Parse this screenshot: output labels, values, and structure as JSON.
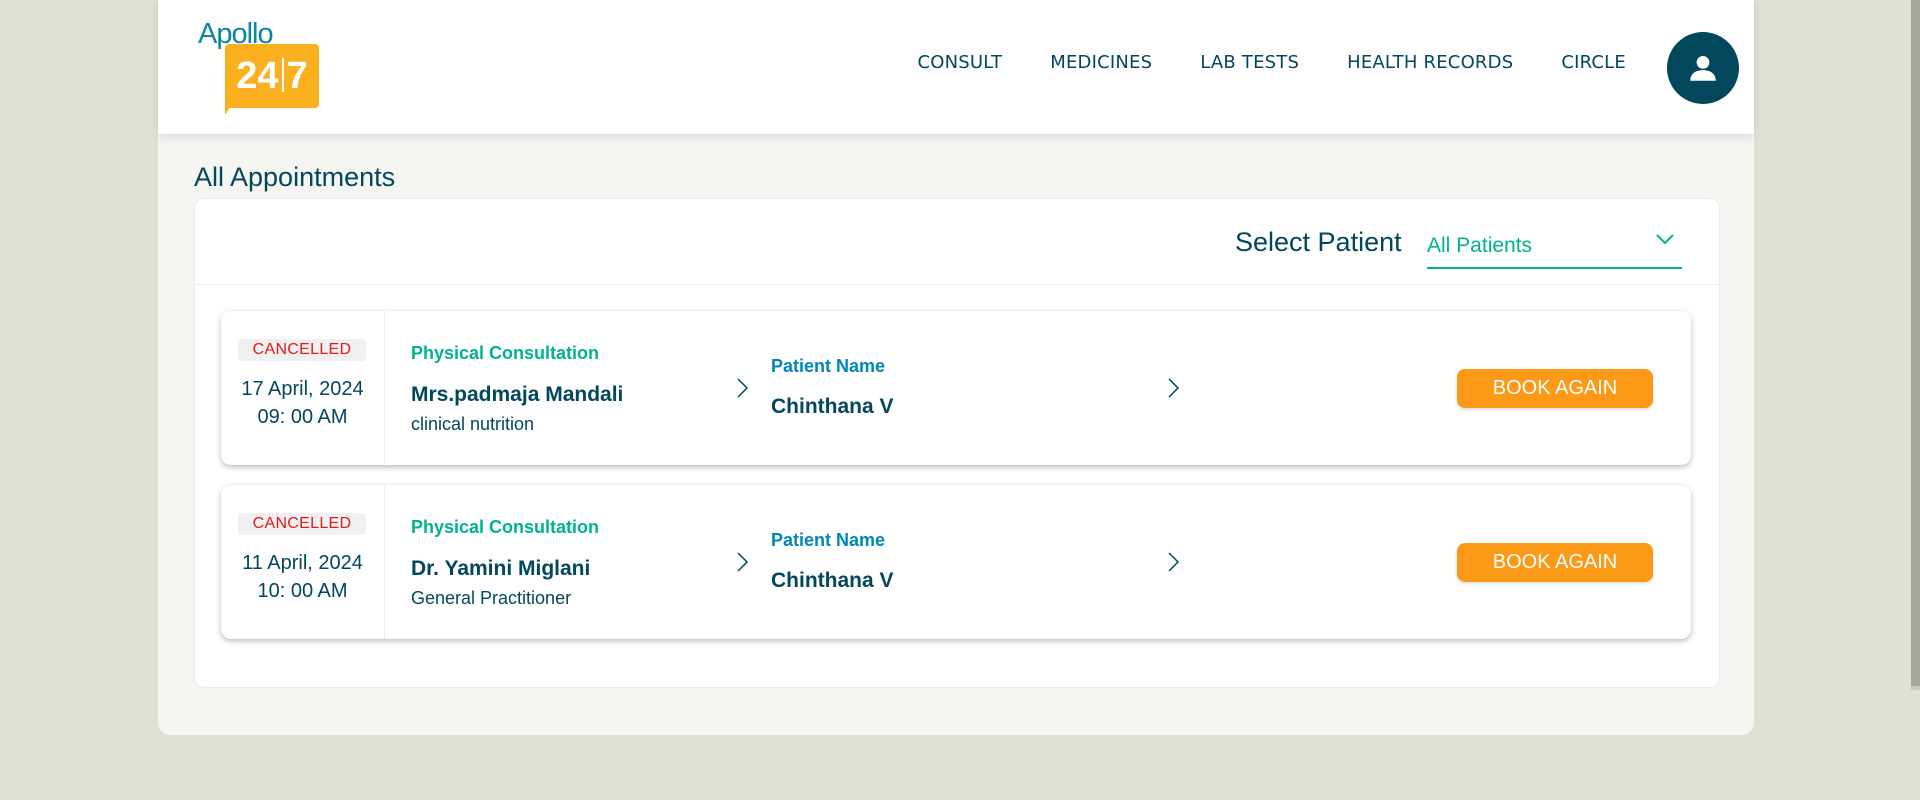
{
  "logo": {
    "brand_top": "Apollo",
    "brand_num": "24",
    "brand_num2": "7"
  },
  "nav": {
    "items": [
      {
        "label": "CONSULT"
      },
      {
        "label": "MEDICINES"
      },
      {
        "label": "LAB TESTS"
      },
      {
        "label": "HEALTH RECORDS"
      },
      {
        "label": "CIRCLE"
      }
    ]
  },
  "page": {
    "title": "All Appointments"
  },
  "filter": {
    "label": "Select Patient",
    "selected": "All Patients"
  },
  "appointments": [
    {
      "status": "CANCELLED",
      "date": "17 April, 2024",
      "time": "09: 00 AM",
      "type": "Physical Consultation",
      "doctor": "Mrs.padmaja Mandali",
      "specialty": "clinical nutrition",
      "patient_label": "Patient Name",
      "patient": "Chinthana V",
      "action": "BOOK AGAIN"
    },
    {
      "status": "CANCELLED",
      "date": "11 April, 2024",
      "time": "10: 00 AM",
      "type": "Physical Consultation",
      "doctor": "Dr. Yamini Miglani",
      "specialty": "General Practitioner",
      "patient_label": "Patient Name",
      "patient": "Chinthana V",
      "action": "BOOK AGAIN"
    }
  ],
  "colors": {
    "primary": "#02475b",
    "accent_green": "#00b38e",
    "accent_blue": "#0087ba",
    "button_orange": "#fc9916",
    "cancelled_red": "#e01b1b",
    "logo_yellow": "#fbb020"
  }
}
